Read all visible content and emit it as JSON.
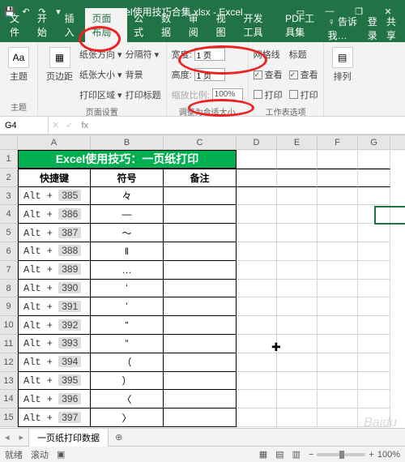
{
  "window": {
    "title": "Excel使用技巧合集.xlsx - Excel"
  },
  "tabs": {
    "items": [
      "文件",
      "开始",
      "插入",
      "页面布局",
      "公式",
      "数据",
      "审阅",
      "视图",
      "开发工具",
      "PDF工具集"
    ],
    "active_index": 3,
    "tell_me": "告诉我…",
    "login": "登录",
    "share": "共享"
  },
  "ribbon": {
    "themes": {
      "big_label": "主题",
      "label": "主题"
    },
    "margins": {
      "big_label": "页边距",
      "items": [
        "纸张方向 ▾",
        "纸张大小 ▾",
        "打印区域 ▾"
      ],
      "items2": [
        "分隔符 ▾",
        "背景",
        "打印标题"
      ],
      "label": "页面设置"
    },
    "scale": {
      "width_label": "宽度:",
      "width_value": "1 页",
      "height_label": "高度:",
      "height_value": "1 页",
      "scale_label": "缩放比例:",
      "scale_value": "100%",
      "label": "调整为合适大小"
    },
    "sheet_opts": {
      "grid_label": "网格线",
      "headings_label": "标题",
      "view_label": "查看",
      "print_label": "打印",
      "label": "工作表选项"
    },
    "arrange": {
      "big_label": "排列"
    }
  },
  "formula_bar": {
    "name": "G4",
    "value": ""
  },
  "grid": {
    "columns": [
      "A",
      "B",
      "C",
      "D",
      "E",
      "F",
      "G"
    ],
    "title_merged": "Excel使用技巧：一页纸打印",
    "headers": [
      "快捷键",
      "符号",
      "备注"
    ],
    "rows": [
      {
        "n": 3,
        "alt": "Alt +",
        "code": "385",
        "sym": "々"
      },
      {
        "n": 4,
        "alt": "Alt +",
        "code": "386",
        "sym": "—"
      },
      {
        "n": 5,
        "alt": "Alt +",
        "code": "387",
        "sym": "～"
      },
      {
        "n": 6,
        "alt": "Alt +",
        "code": "388",
        "sym": "‖"
      },
      {
        "n": 7,
        "alt": "Alt +",
        "code": "389",
        "sym": "…"
      },
      {
        "n": 8,
        "alt": "Alt +",
        "code": "390",
        "sym": "‘"
      },
      {
        "n": 9,
        "alt": "Alt +",
        "code": "391",
        "sym": "’"
      },
      {
        "n": 10,
        "alt": "Alt +",
        "code": "392",
        "sym": "“"
      },
      {
        "n": 11,
        "alt": "Alt +",
        "code": "393",
        "sym": "”"
      },
      {
        "n": 12,
        "alt": "Alt +",
        "code": "394",
        "sym": "（"
      },
      {
        "n": 13,
        "alt": "Alt +",
        "code": "395",
        "sym": "）"
      },
      {
        "n": 14,
        "alt": "Alt +",
        "code": "396",
        "sym": "〈"
      },
      {
        "n": 15,
        "alt": "Alt +",
        "code": "397",
        "sym": "〉"
      }
    ]
  },
  "sheet_tabs": {
    "active": "一页纸打印数据"
  },
  "status": {
    "ready": "就绪",
    "scroll": "滚动",
    "rec": "",
    "zoom": "100%"
  },
  "watermark": "Baidu"
}
